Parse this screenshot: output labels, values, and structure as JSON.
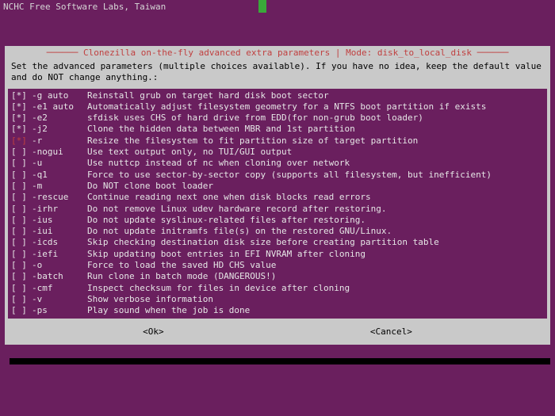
{
  "header": {
    "lab_text": "NCHC Free Software Labs, Taiwan"
  },
  "dialog": {
    "title": "Clonezilla on-the-fly advanced extra parameters | Mode: disk_to_local_disk",
    "instructions": "Set the advanced parameters (multiple choices available). If you have no idea, keep the default value and do NOT change anything.:",
    "options": [
      {
        "checked": true,
        "highlight": false,
        "flag": "-g auto",
        "desc": "Reinstall grub on target hard disk boot sector"
      },
      {
        "checked": true,
        "highlight": false,
        "flag": "-e1 auto",
        "desc": "Automatically adjust filesystem geometry for a NTFS boot partition if exists"
      },
      {
        "checked": true,
        "highlight": false,
        "flag": "-e2",
        "desc": "sfdisk uses CHS of hard drive from EDD(for non-grub boot loader)"
      },
      {
        "checked": true,
        "highlight": false,
        "flag": "-j2",
        "desc": "Clone the hidden data between MBR and 1st partition"
      },
      {
        "checked": true,
        "highlight": true,
        "flag": "-r",
        "desc": "Resize the filesystem to fit partition size of target partition"
      },
      {
        "checked": false,
        "highlight": false,
        "flag": "-nogui",
        "desc": "Use text output only, no TUI/GUI output"
      },
      {
        "checked": false,
        "highlight": false,
        "flag": "-u",
        "desc": "Use nuttcp instead of nc when cloning over network"
      },
      {
        "checked": false,
        "highlight": false,
        "flag": "-q1",
        "desc": "Force to use sector-by-sector copy (supports all filesystem, but inefficient)"
      },
      {
        "checked": false,
        "highlight": false,
        "flag": "-m",
        "desc": "Do NOT clone boot loader"
      },
      {
        "checked": false,
        "highlight": false,
        "flag": "-rescue",
        "desc": "Continue reading next one when disk blocks read errors"
      },
      {
        "checked": false,
        "highlight": false,
        "flag": "-irhr",
        "desc": "Do not remove Linux udev hardware record after restoring."
      },
      {
        "checked": false,
        "highlight": false,
        "flag": "-ius",
        "desc": "Do not update syslinux-related files after restoring."
      },
      {
        "checked": false,
        "highlight": false,
        "flag": "-iui",
        "desc": "Do not update initramfs file(s) on the restored GNU/Linux."
      },
      {
        "checked": false,
        "highlight": false,
        "flag": "-icds",
        "desc": "Skip checking destination disk size before creating partition table"
      },
      {
        "checked": false,
        "highlight": false,
        "flag": "-iefi",
        "desc": "Skip updating boot entries in EFI NVRAM after cloning"
      },
      {
        "checked": false,
        "highlight": false,
        "flag": "-o",
        "desc": "Force to load the saved HD CHS value"
      },
      {
        "checked": false,
        "highlight": false,
        "flag": "-batch",
        "desc": "Run clone in batch mode (DANGEROUS!)"
      },
      {
        "checked": false,
        "highlight": false,
        "flag": "-cmf",
        "desc": "Inspect checksum for files in device after cloning"
      },
      {
        "checked": false,
        "highlight": false,
        "flag": "-v",
        "desc": "Show verbose information"
      },
      {
        "checked": false,
        "highlight": false,
        "flag": "-ps",
        "desc": "Play sound when the job is done"
      }
    ],
    "buttons": {
      "ok": "<Ok>",
      "cancel": "<Cancel>"
    }
  }
}
